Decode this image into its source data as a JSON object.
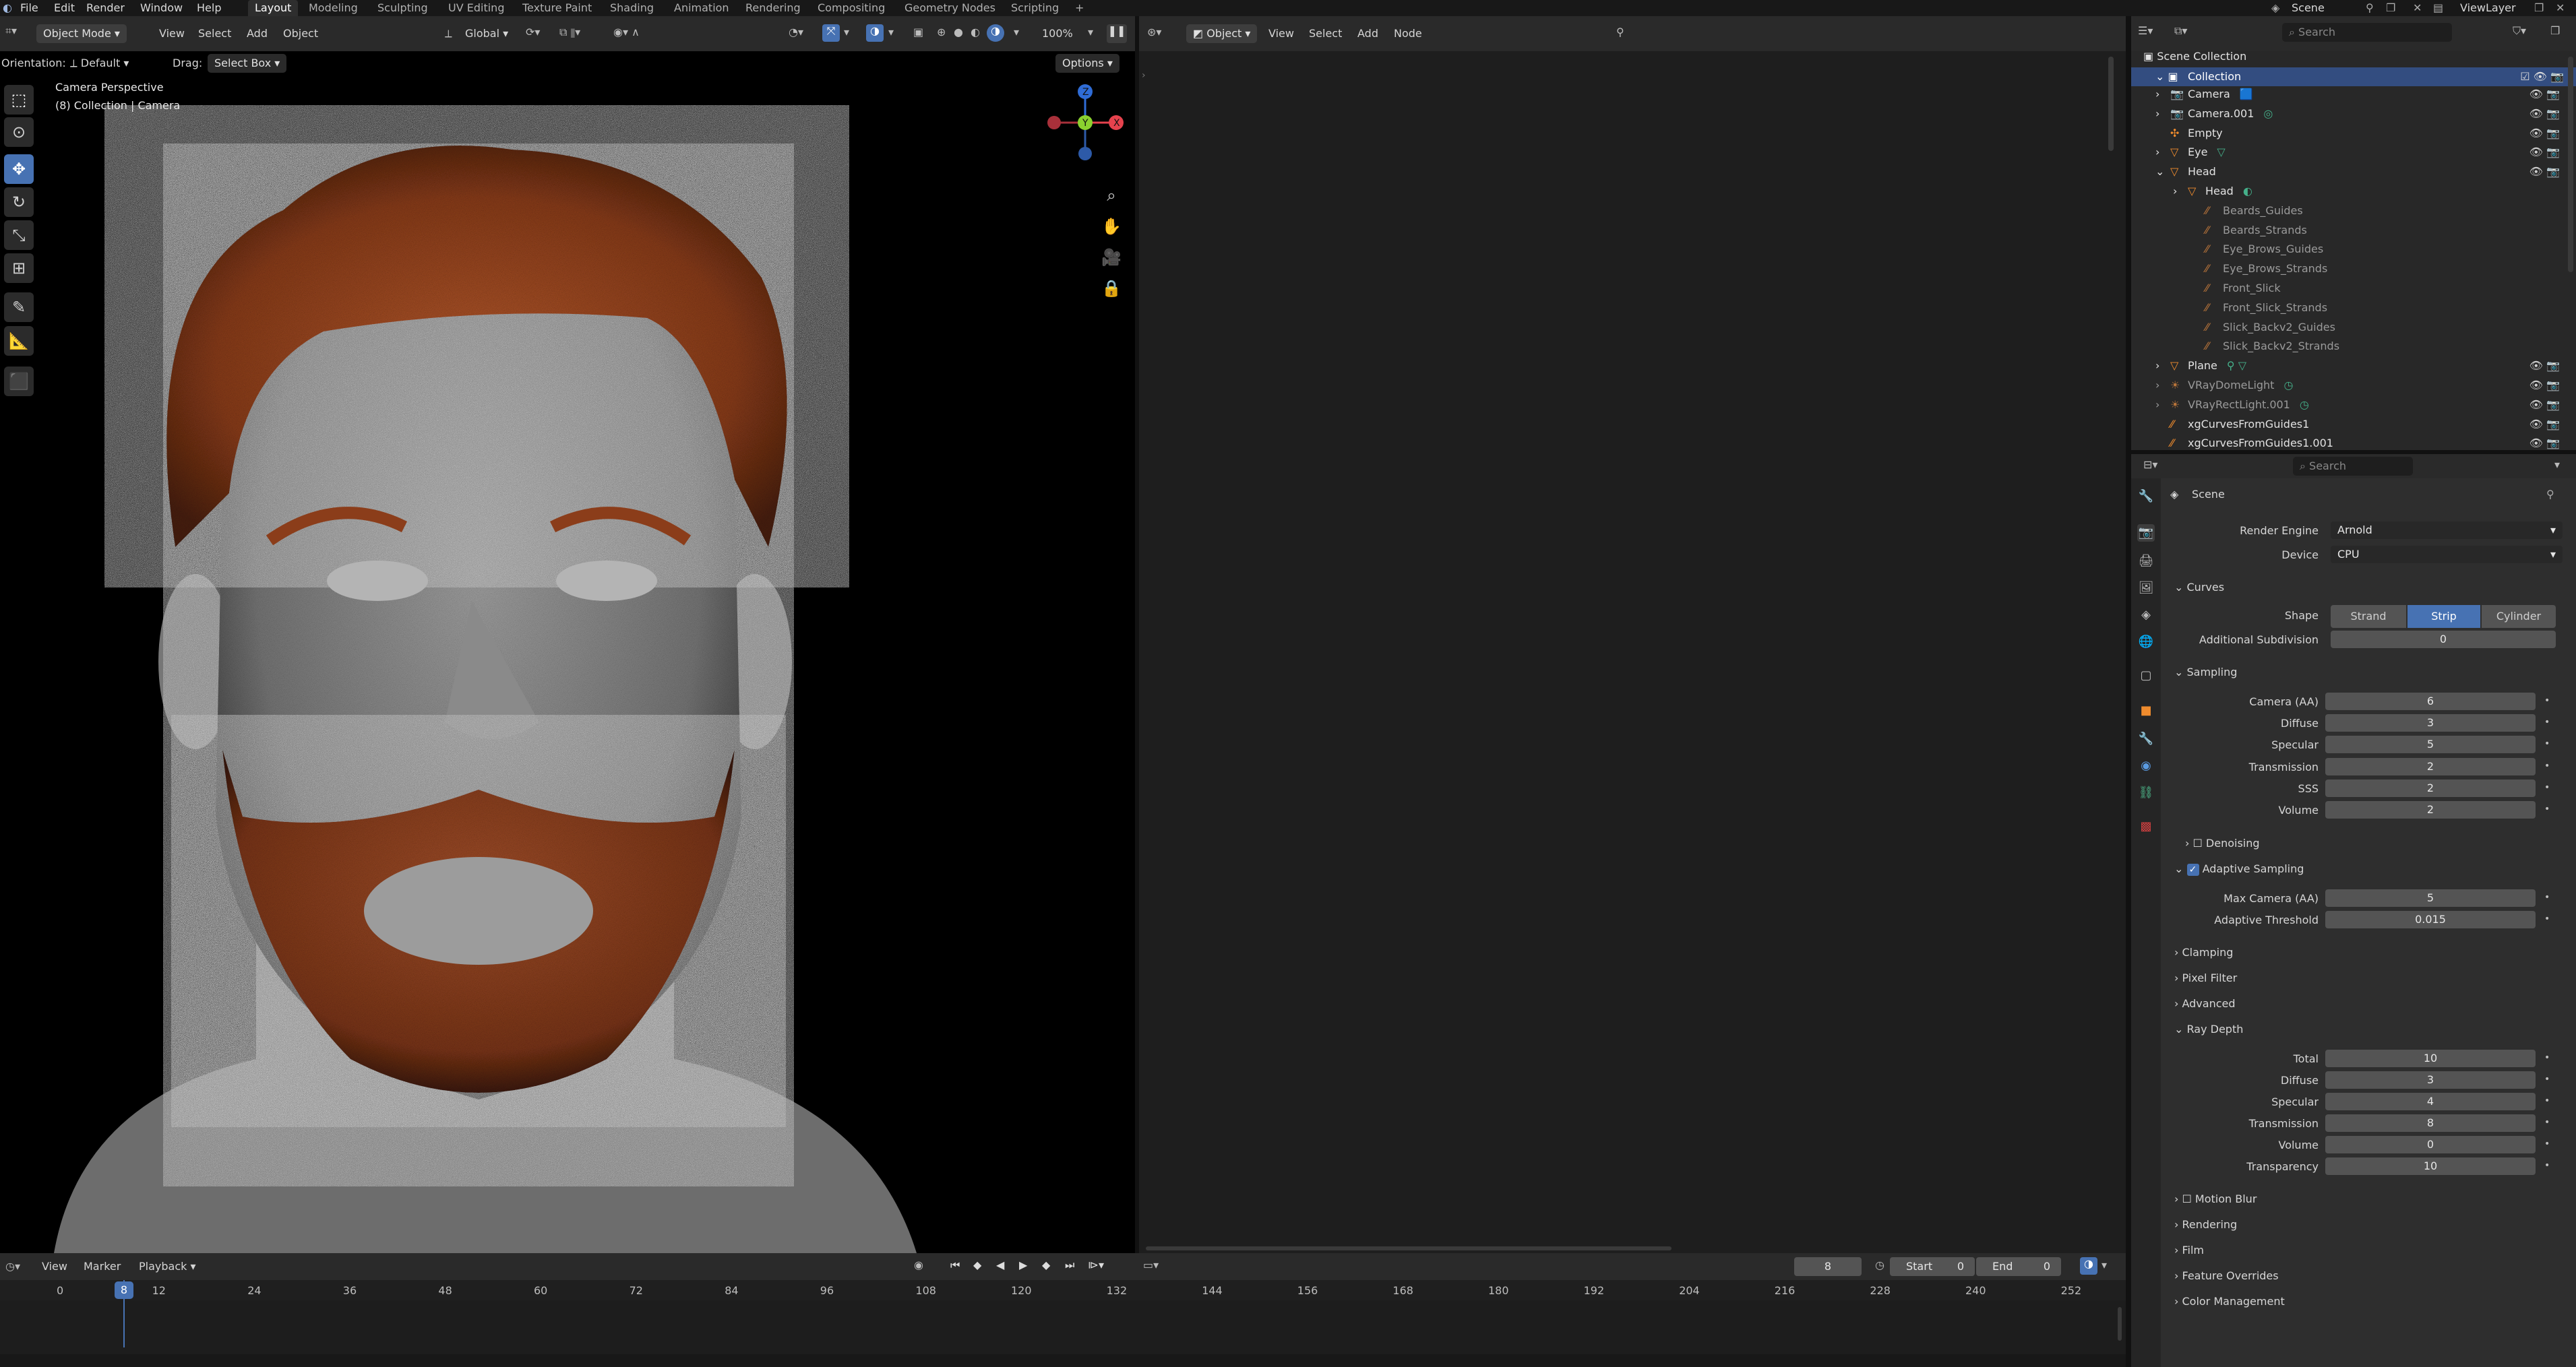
{
  "menubar": {
    "menus": [
      "File",
      "Edit",
      "Render",
      "Window",
      "Help"
    ],
    "workspaces": [
      "Layout",
      "Modeling",
      "Sculpting",
      "UV Editing",
      "Texture Paint",
      "Shading",
      "Animation",
      "Rendering",
      "Compositing",
      "Geometry Nodes",
      "Scripting"
    ],
    "active_workspace": "Layout",
    "add_tab": "+",
    "scene": "Scene",
    "view_layer": "ViewLayer"
  },
  "viewport": {
    "mode": "Object Mode",
    "menus": [
      "View",
      "Select",
      "Add",
      "Object"
    ],
    "transform": "Global",
    "zoom": "100%",
    "orientation_label": "Orientation:",
    "orientation_value": "Default",
    "drag_label": "Drag:",
    "drag_value": "Select Box",
    "options": "Options",
    "overlay_title": "Camera Perspective",
    "overlay_subtitle": "(8) Collection | Camera",
    "gizmo": {
      "x": "X",
      "y": "Y",
      "z": "Z"
    },
    "colors": {
      "hair": "#a14a22",
      "skin": "#9a9a9a",
      "bg": "#000000",
      "select": "#4772b3"
    }
  },
  "node_editor": {
    "type": "Object",
    "menus": [
      "View",
      "Select",
      "Add",
      "Node"
    ]
  },
  "outliner": {
    "search_placeholder": "Search",
    "scene_collection": "Scene Collection",
    "collection": "Collection",
    "items": [
      {
        "name": "Camera",
        "dim": false
      },
      {
        "name": "Camera.001",
        "dim": false
      },
      {
        "name": "Empty",
        "dim": false
      },
      {
        "name": "Eye",
        "dim": false
      },
      {
        "name": "Head",
        "dim": false
      },
      {
        "name": "Head",
        "dim": false
      },
      {
        "name": "Beards_Guides",
        "dim": true
      },
      {
        "name": "Beards_Strands",
        "dim": true
      },
      {
        "name": "Eye_Brows_Guides",
        "dim": true
      },
      {
        "name": "Eye_Brows_Strands",
        "dim": true
      },
      {
        "name": "Front_Slick",
        "dim": true
      },
      {
        "name": "Front_Slick_Strands",
        "dim": true
      },
      {
        "name": "Slick_Backv2_Guides",
        "dim": true
      },
      {
        "name": "Slick_Backv2_Strands",
        "dim": true
      },
      {
        "name": "Plane",
        "dim": false
      },
      {
        "name": "VRayDomeLight",
        "dim": true
      },
      {
        "name": "VRayRectLight.001",
        "dim": true
      },
      {
        "name": "xgCurvesFromGuides1",
        "dim": false
      },
      {
        "name": "xgCurvesFromGuides1.001",
        "dim": false
      }
    ]
  },
  "properties": {
    "search_placeholder": "Search",
    "context": "Scene",
    "render_engine_label": "Render Engine",
    "render_engine": "Arnold",
    "device_label": "Device",
    "device": "CPU",
    "curves": {
      "title": "Curves",
      "shape_label": "Shape",
      "shapes": [
        "Strand",
        "Strip",
        "Cylinder"
      ],
      "shape_selected": "Strip",
      "subdiv_label": "Additional Subdivision",
      "subdiv": "0"
    },
    "sampling": {
      "title": "Sampling",
      "rows": [
        {
          "label": "Camera (AA)",
          "value": "6"
        },
        {
          "label": "Diffuse",
          "value": "3"
        },
        {
          "label": "Specular",
          "value": "5"
        },
        {
          "label": "Transmission",
          "value": "2"
        },
        {
          "label": "SSS",
          "value": "2"
        },
        {
          "label": "Volume",
          "value": "2"
        }
      ]
    },
    "denoising": "Denoising",
    "adaptive": {
      "title": "Adaptive Sampling",
      "rows": [
        {
          "label": "Max Camera (AA)",
          "value": "5"
        },
        {
          "label": "Adaptive Threshold",
          "value": "0.015"
        }
      ]
    },
    "clamping": "Clamping",
    "pixel_filter": "Pixel Filter",
    "advanced": "Advanced",
    "ray_depth": {
      "title": "Ray Depth",
      "rows": [
        {
          "label": "Total",
          "value": "10"
        },
        {
          "label": "Diffuse",
          "value": "3"
        },
        {
          "label": "Specular",
          "value": "4"
        },
        {
          "label": "Transmission",
          "value": "8"
        },
        {
          "label": "Volume",
          "value": "0"
        },
        {
          "label": "Transparency",
          "value": "10"
        }
      ]
    },
    "motion_blur": "Motion Blur",
    "rendering": "Rendering",
    "film": "Film",
    "feature_overrides": "Feature Overrides",
    "color_management": "Color Management"
  },
  "timeline": {
    "menus": [
      "View",
      "Marker",
      "Playback"
    ],
    "current_frame": "8",
    "start_label": "Start",
    "start": "0",
    "end_label": "End",
    "end": "0",
    "ticks": [
      "0",
      "8",
      "12",
      "24",
      "36",
      "48",
      "60",
      "72",
      "84",
      "96",
      "108",
      "120",
      "132",
      "144",
      "156",
      "168",
      "180",
      "192",
      "204",
      "216",
      "228",
      "240",
      "252"
    ]
  }
}
